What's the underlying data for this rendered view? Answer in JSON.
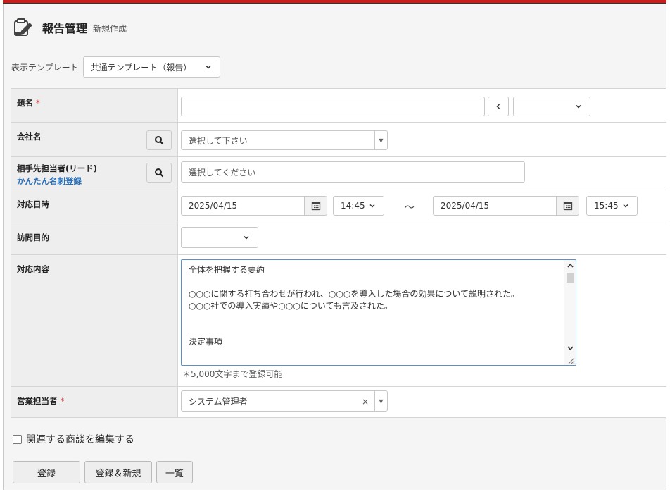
{
  "header": {
    "title": "報告管理",
    "subtitle": "新規作成",
    "icon": "edit-report-icon"
  },
  "template": {
    "label": "表示テンプレート",
    "selected": "共通テンプレート（報告）"
  },
  "fields": {
    "subject": {
      "label": "題名",
      "required_mark": "*",
      "value": "",
      "prev_button": "‹",
      "select_value": ""
    },
    "company": {
      "label": "会社名",
      "placeholder": "選択して下さい"
    },
    "contact": {
      "label": "相手先担当者(リード)",
      "link": "かんたん名刺登録",
      "placeholder": "選択してください"
    },
    "datetime": {
      "label": "対応日時",
      "start_date": "2025/04/15",
      "start_time": "14:45",
      "separator": "～",
      "end_date": "2025/04/15",
      "end_time": "15:45"
    },
    "purpose": {
      "label": "訪問目的",
      "value": ""
    },
    "content": {
      "label": "対応内容",
      "lines": [
        "全体を把握する要約",
        "",
        "○○○に関する打ち合わせが行われ、○○○を導入した場合の効果について説明された。",
        "○○○社での導入実績や○○○についても言及された。",
        "",
        "",
        "決定事項",
        ""
      ],
      "note": "＊5,000文字まで登録可能"
    },
    "sales_rep": {
      "label": "営業担当者",
      "required_mark": "*",
      "value": "システム管理者",
      "clear": "×",
      "arrow": "▼"
    }
  },
  "related": {
    "label": "関連する商談を編集する",
    "checked": false
  },
  "buttons": {
    "register": "登録",
    "register_new": "登録＆新規",
    "list": "一覧"
  },
  "colors": {
    "top_bar": "#c81e1e",
    "link": "#2a6fb8",
    "required": "#d33333",
    "focus_border": "#5a8fc8"
  }
}
